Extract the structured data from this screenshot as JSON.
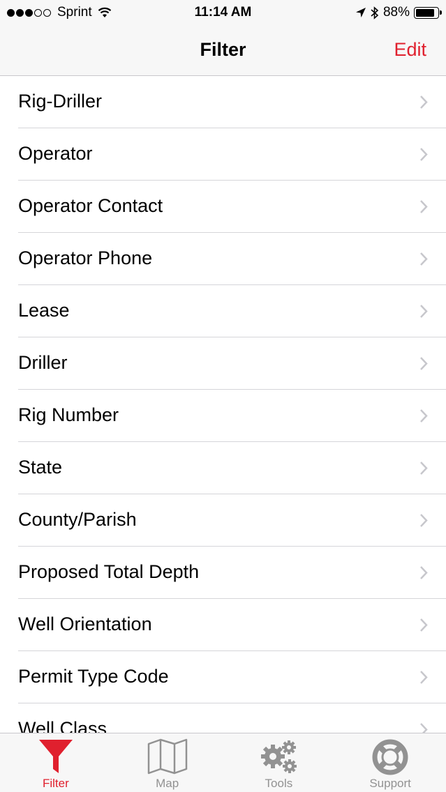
{
  "status_bar": {
    "carrier": "Sprint",
    "time": "11:14 AM",
    "battery_percent": "88%",
    "battery_level": 0.88,
    "signal_bars_filled": 3,
    "signal_bars_total": 5
  },
  "nav": {
    "title": "Filter",
    "edit_label": "Edit"
  },
  "filter_items": [
    {
      "label": "Rig-Driller"
    },
    {
      "label": "Operator"
    },
    {
      "label": "Operator Contact"
    },
    {
      "label": "Operator Phone"
    },
    {
      "label": "Lease"
    },
    {
      "label": "Driller"
    },
    {
      "label": "Rig Number"
    },
    {
      "label": "State"
    },
    {
      "label": "County/Parish"
    },
    {
      "label": "Proposed Total Depth"
    },
    {
      "label": "Well Orientation"
    },
    {
      "label": "Permit Type Code"
    },
    {
      "label": "Well Class"
    }
  ],
  "tabs": [
    {
      "label": "Filter",
      "icon": "filter-funnel-icon",
      "active": true
    },
    {
      "label": "Map",
      "icon": "map-icon",
      "active": false
    },
    {
      "label": "Tools",
      "icon": "gears-icon",
      "active": false
    },
    {
      "label": "Support",
      "icon": "lifebuoy-icon",
      "active": false
    }
  ],
  "colors": {
    "accent": "#e0202e",
    "inactive_tab": "#929292",
    "separator": "#d5d5d9",
    "bar_background": "#f7f7f7"
  }
}
